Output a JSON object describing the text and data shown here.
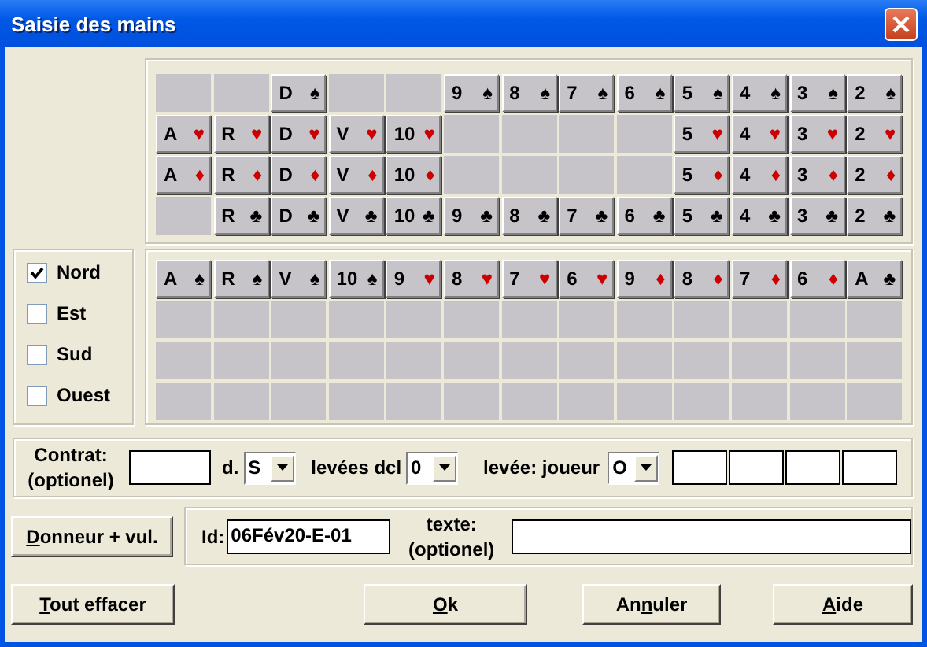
{
  "window": {
    "title": "Saisie des mains"
  },
  "deck": [
    [
      {
        "kind": "empty"
      },
      {
        "kind": "empty"
      },
      {
        "kind": "card",
        "rank": "D",
        "suit": "♠",
        "color": "#000000"
      },
      {
        "kind": "empty"
      },
      {
        "kind": "empty"
      },
      {
        "kind": "card",
        "rank": "9",
        "suit": "♠",
        "color": "#000000"
      },
      {
        "kind": "card",
        "rank": "8",
        "suit": "♠",
        "color": "#000000"
      },
      {
        "kind": "card",
        "rank": "7",
        "suit": "♠",
        "color": "#000000"
      },
      {
        "kind": "card",
        "rank": "6",
        "suit": "♠",
        "color": "#000000"
      },
      {
        "kind": "card",
        "rank": "5",
        "suit": "♠",
        "color": "#000000"
      },
      {
        "kind": "card",
        "rank": "4",
        "suit": "♠",
        "color": "#000000"
      },
      {
        "kind": "card",
        "rank": "3",
        "suit": "♠",
        "color": "#000000"
      },
      {
        "kind": "card",
        "rank": "2",
        "suit": "♠",
        "color": "#000000"
      }
    ],
    [
      {
        "kind": "card",
        "rank": "A",
        "suit": "♥",
        "color": "#cc0000"
      },
      {
        "kind": "card",
        "rank": "R",
        "suit": "♥",
        "color": "#cc0000"
      },
      {
        "kind": "card",
        "rank": "D",
        "suit": "♥",
        "color": "#cc0000"
      },
      {
        "kind": "card",
        "rank": "V",
        "suit": "♥",
        "color": "#cc0000"
      },
      {
        "kind": "card",
        "rank": "10",
        "suit": "♥",
        "color": "#cc0000"
      },
      {
        "kind": "empty"
      },
      {
        "kind": "empty"
      },
      {
        "kind": "empty"
      },
      {
        "kind": "empty"
      },
      {
        "kind": "card",
        "rank": "5",
        "suit": "♥",
        "color": "#cc0000"
      },
      {
        "kind": "card",
        "rank": "4",
        "suit": "♥",
        "color": "#cc0000"
      },
      {
        "kind": "card",
        "rank": "3",
        "suit": "♥",
        "color": "#cc0000"
      },
      {
        "kind": "card",
        "rank": "2",
        "suit": "♥",
        "color": "#cc0000"
      }
    ],
    [
      {
        "kind": "card",
        "rank": "A",
        "suit": "♦",
        "color": "#cc0000"
      },
      {
        "kind": "card",
        "rank": "R",
        "suit": "♦",
        "color": "#cc0000"
      },
      {
        "kind": "card",
        "rank": "D",
        "suit": "♦",
        "color": "#cc0000"
      },
      {
        "kind": "card",
        "rank": "V",
        "suit": "♦",
        "color": "#cc0000"
      },
      {
        "kind": "card",
        "rank": "10",
        "suit": "♦",
        "color": "#cc0000"
      },
      {
        "kind": "empty"
      },
      {
        "kind": "empty"
      },
      {
        "kind": "empty"
      },
      {
        "kind": "empty"
      },
      {
        "kind": "card",
        "rank": "5",
        "suit": "♦",
        "color": "#cc0000"
      },
      {
        "kind": "card",
        "rank": "4",
        "suit": "♦",
        "color": "#cc0000"
      },
      {
        "kind": "card",
        "rank": "3",
        "suit": "♦",
        "color": "#cc0000"
      },
      {
        "kind": "card",
        "rank": "2",
        "suit": "♦",
        "color": "#cc0000"
      }
    ],
    [
      {
        "kind": "empty"
      },
      {
        "kind": "card",
        "rank": "R",
        "suit": "♣",
        "color": "#000000"
      },
      {
        "kind": "card",
        "rank": "D",
        "suit": "♣",
        "color": "#000000"
      },
      {
        "kind": "card",
        "rank": "V",
        "suit": "♣",
        "color": "#000000"
      },
      {
        "kind": "card",
        "rank": "10",
        "suit": "♣",
        "color": "#000000"
      },
      {
        "kind": "card",
        "rank": "9",
        "suit": "♣",
        "color": "#000000"
      },
      {
        "kind": "card",
        "rank": "8",
        "suit": "♣",
        "color": "#000000"
      },
      {
        "kind": "card",
        "rank": "7",
        "suit": "♣",
        "color": "#000000"
      },
      {
        "kind": "card",
        "rank": "6",
        "suit": "♣",
        "color": "#000000"
      },
      {
        "kind": "card",
        "rank": "5",
        "suit": "♣",
        "color": "#000000"
      },
      {
        "kind": "card",
        "rank": "4",
        "suit": "♣",
        "color": "#000000"
      },
      {
        "kind": "card",
        "rank": "3",
        "suit": "♣",
        "color": "#000000"
      },
      {
        "kind": "card",
        "rank": "2",
        "suit": "♣",
        "color": "#000000"
      }
    ]
  ],
  "players": [
    {
      "name": "Nord",
      "checked": true,
      "cards": [
        {
          "kind": "card",
          "rank": "A",
          "suit": "♠",
          "color": "#000000"
        },
        {
          "kind": "card",
          "rank": "R",
          "suit": "♠",
          "color": "#000000"
        },
        {
          "kind": "card",
          "rank": "V",
          "suit": "♠",
          "color": "#000000"
        },
        {
          "kind": "card",
          "rank": "10",
          "suit": "♠",
          "color": "#000000"
        },
        {
          "kind": "card",
          "rank": "9",
          "suit": "♥",
          "color": "#cc0000"
        },
        {
          "kind": "card",
          "rank": "8",
          "suit": "♥",
          "color": "#cc0000"
        },
        {
          "kind": "card",
          "rank": "7",
          "suit": "♥",
          "color": "#cc0000"
        },
        {
          "kind": "card",
          "rank": "6",
          "suit": "♥",
          "color": "#cc0000"
        },
        {
          "kind": "card",
          "rank": "9",
          "suit": "♦",
          "color": "#cc0000"
        },
        {
          "kind": "card",
          "rank": "8",
          "suit": "♦",
          "color": "#cc0000"
        },
        {
          "kind": "card",
          "rank": "7",
          "suit": "♦",
          "color": "#cc0000"
        },
        {
          "kind": "card",
          "rank": "6",
          "suit": "♦",
          "color": "#cc0000"
        },
        {
          "kind": "card",
          "rank": "A",
          "suit": "♣",
          "color": "#000000"
        }
      ]
    },
    {
      "name": "Est",
      "checked": false,
      "cards": [
        {
          "kind": "empty"
        },
        {
          "kind": "empty"
        },
        {
          "kind": "empty"
        },
        {
          "kind": "empty"
        },
        {
          "kind": "empty"
        },
        {
          "kind": "empty"
        },
        {
          "kind": "empty"
        },
        {
          "kind": "empty"
        },
        {
          "kind": "empty"
        },
        {
          "kind": "empty"
        },
        {
          "kind": "empty"
        },
        {
          "kind": "empty"
        },
        {
          "kind": "empty"
        }
      ]
    },
    {
      "name": "Sud",
      "checked": false,
      "cards": [
        {
          "kind": "empty"
        },
        {
          "kind": "empty"
        },
        {
          "kind": "empty"
        },
        {
          "kind": "empty"
        },
        {
          "kind": "empty"
        },
        {
          "kind": "empty"
        },
        {
          "kind": "empty"
        },
        {
          "kind": "empty"
        },
        {
          "kind": "empty"
        },
        {
          "kind": "empty"
        },
        {
          "kind": "empty"
        },
        {
          "kind": "empty"
        },
        {
          "kind": "empty"
        }
      ]
    },
    {
      "name": "Ouest",
      "checked": false,
      "cards": [
        {
          "kind": "empty"
        },
        {
          "kind": "empty"
        },
        {
          "kind": "empty"
        },
        {
          "kind": "empty"
        },
        {
          "kind": "empty"
        },
        {
          "kind": "empty"
        },
        {
          "kind": "empty"
        },
        {
          "kind": "empty"
        },
        {
          "kind": "empty"
        },
        {
          "kind": "empty"
        },
        {
          "kind": "empty"
        },
        {
          "kind": "empty"
        },
        {
          "kind": "empty"
        }
      ]
    }
  ],
  "contract": {
    "label": [
      "Contrat:",
      "(optionel)"
    ],
    "declarer_label": "d.",
    "declarer": "S",
    "tricks_label": "levées dcl",
    "tricks": "0",
    "lead_label": "levée: joueur",
    "lead_player": "O",
    "lead_cards": [
      {
        "kind": "field"
      },
      {
        "kind": "field"
      },
      {
        "kind": "field"
      },
      {
        "kind": "field"
      }
    ]
  },
  "info": {
    "id_label": "Id:",
    "id": "06Fév20-E-01",
    "text_label": [
      "texte:",
      "(optionel)"
    ]
  },
  "buttons": [
    {
      "kind": "dealer",
      "key": "D",
      "after": "onneur + vul."
    },
    {
      "kind": "clear",
      "key": "T",
      "after": "out effacer"
    },
    {
      "kind": "ok",
      "key": "O",
      "after": "k"
    },
    {
      "kind": "cancel",
      "before": "An",
      "key": "n",
      "after": "uler"
    },
    {
      "kind": "help",
      "key": "A",
      "after": "ide"
    }
  ]
}
